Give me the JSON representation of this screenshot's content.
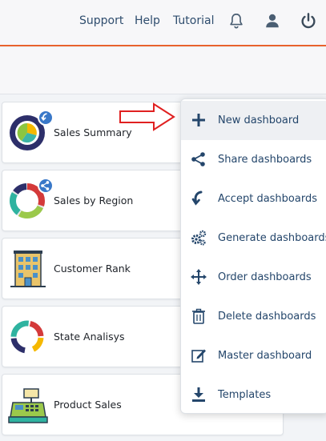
{
  "topnav": {
    "support": "Support",
    "help": "Help",
    "tutorial": "Tutorial"
  },
  "icons": {
    "bell": "bell-icon",
    "user": "user-icon",
    "power": "power-icon"
  },
  "dashboards": [
    {
      "label": "Sales Summary",
      "icon": "pie-chart-icon",
      "badge": "accept-icon"
    },
    {
      "label": "Sales by Region",
      "icon": "donut-chart-icon",
      "badge": "share-icon"
    },
    {
      "label": "Customer Rank",
      "icon": "building-icon"
    },
    {
      "label": "State Analisys",
      "icon": "ring-chart-icon"
    },
    {
      "label": "Product Sales",
      "icon": "cash-register-icon"
    }
  ],
  "menu": {
    "items": [
      {
        "label": "New dashboard",
        "icon": "plus-icon"
      },
      {
        "label": "Share dashboards",
        "icon": "share-icon"
      },
      {
        "label": "Accept dashboards",
        "icon": "accept-icon"
      },
      {
        "label": "Generate dashboards",
        "icon": "gears-icon"
      },
      {
        "label": "Order dashboards",
        "icon": "move-icon"
      },
      {
        "label": "Delete dashboards",
        "icon": "trash-icon"
      },
      {
        "label": "Master dashboard",
        "icon": "edit-icon"
      },
      {
        "label": "Templates",
        "icon": "download-icon"
      }
    ]
  },
  "colors": {
    "accent_orange": "#e8622d",
    "nav_text": "#2f4d6e",
    "menu_text": "#24466b",
    "badge_blue": "#3978c8",
    "arrow_red": "#e02020"
  }
}
